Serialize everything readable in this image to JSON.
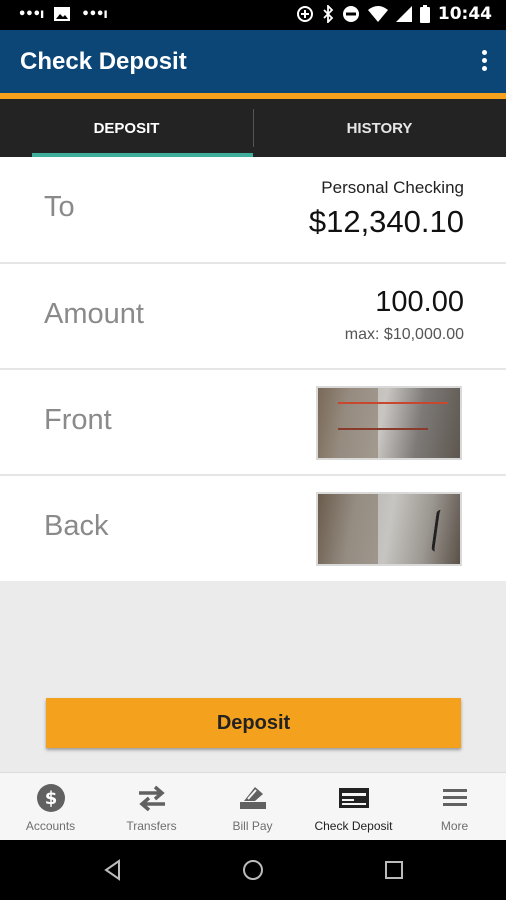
{
  "status_bar": {
    "time": "10:44"
  },
  "app_bar": {
    "title": "Check Deposit"
  },
  "tabs": [
    {
      "label": "DEPOSIT",
      "selected": true
    },
    {
      "label": "HISTORY",
      "selected": false
    }
  ],
  "form": {
    "to": {
      "label": "To",
      "account": "Personal Checking",
      "balance": "$12,340.10"
    },
    "amount": {
      "label": "Amount",
      "value": "100.00",
      "max": "max: $10,000.00"
    },
    "front": {
      "label": "Front"
    },
    "back": {
      "label": "Back"
    }
  },
  "deposit_button": {
    "label": "Deposit"
  },
  "bottom_nav": {
    "items": [
      {
        "label": "Accounts",
        "icon": "dollar-circle-icon"
      },
      {
        "label": "Transfers",
        "icon": "transfer-arrows-icon"
      },
      {
        "label": "Bill Pay",
        "icon": "bill-pay-icon"
      },
      {
        "label": "Check Deposit",
        "icon": "check-deposit-icon",
        "active": true
      },
      {
        "label": "More",
        "icon": "menu-icon"
      }
    ]
  },
  "colors": {
    "app_bar": "#0b4677",
    "accent": "#f5a11c",
    "tab_indicator": "#3fae9a",
    "button": "#f4a21e"
  }
}
